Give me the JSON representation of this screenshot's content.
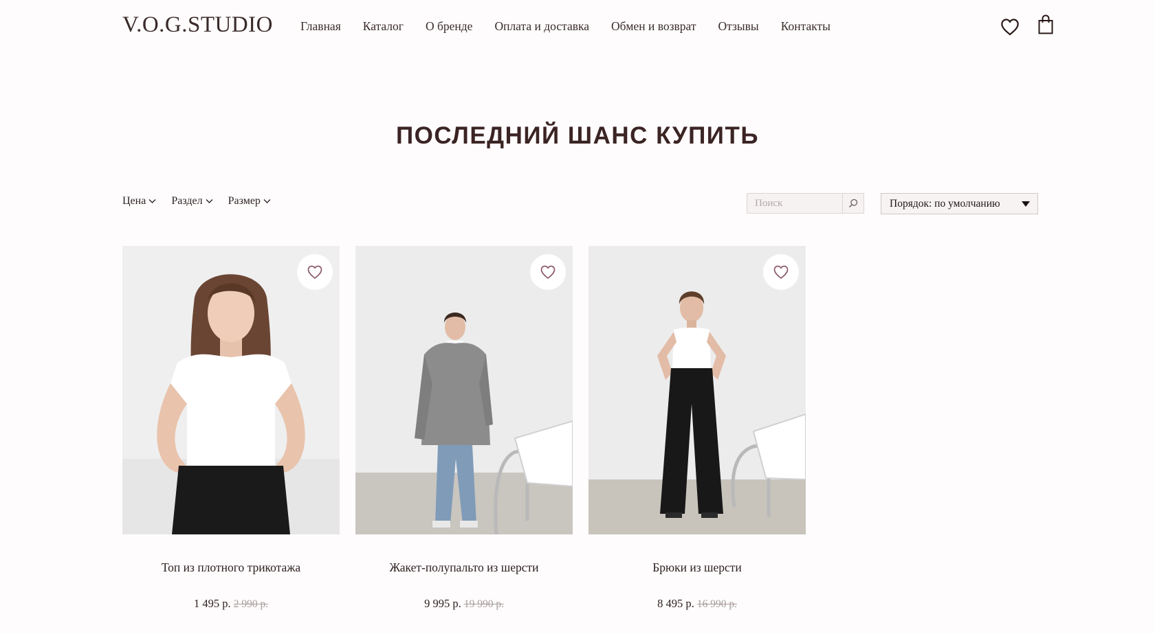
{
  "header": {
    "logo": "V.O.G.STUDIO",
    "nav": [
      "Главная",
      "Каталог",
      "О бренде",
      "Оплата и доставка",
      "Обмен и возврат",
      "Отзывы",
      "Контакты"
    ],
    "icons": [
      "heart-icon",
      "shopping-bag-icon"
    ]
  },
  "page": {
    "title": "ПОСЛЕДНИЙ ШАНС КУПИТЬ"
  },
  "filters": {
    "price": "Цена",
    "section": "Раздел",
    "size": "Размер"
  },
  "search": {
    "placeholder": "Поиск"
  },
  "sort": {
    "label": "Порядок: по умолчанию"
  },
  "products": [
    {
      "name": "Топ из плотного трикотажа",
      "price": "1 495 р.",
      "old_price": "2 990 р."
    },
    {
      "name": "Жакет-полупальто из шерсти",
      "price": "9 995 р.",
      "old_price": "19 990 р."
    },
    {
      "name": "Брюки из шерсти",
      "price": "8 495 р.",
      "old_price": "16 990 р."
    }
  ],
  "colors": {
    "text": "#2b1a1a",
    "accent_heart": "#8a5a6a",
    "background": "#fefcfc"
  }
}
